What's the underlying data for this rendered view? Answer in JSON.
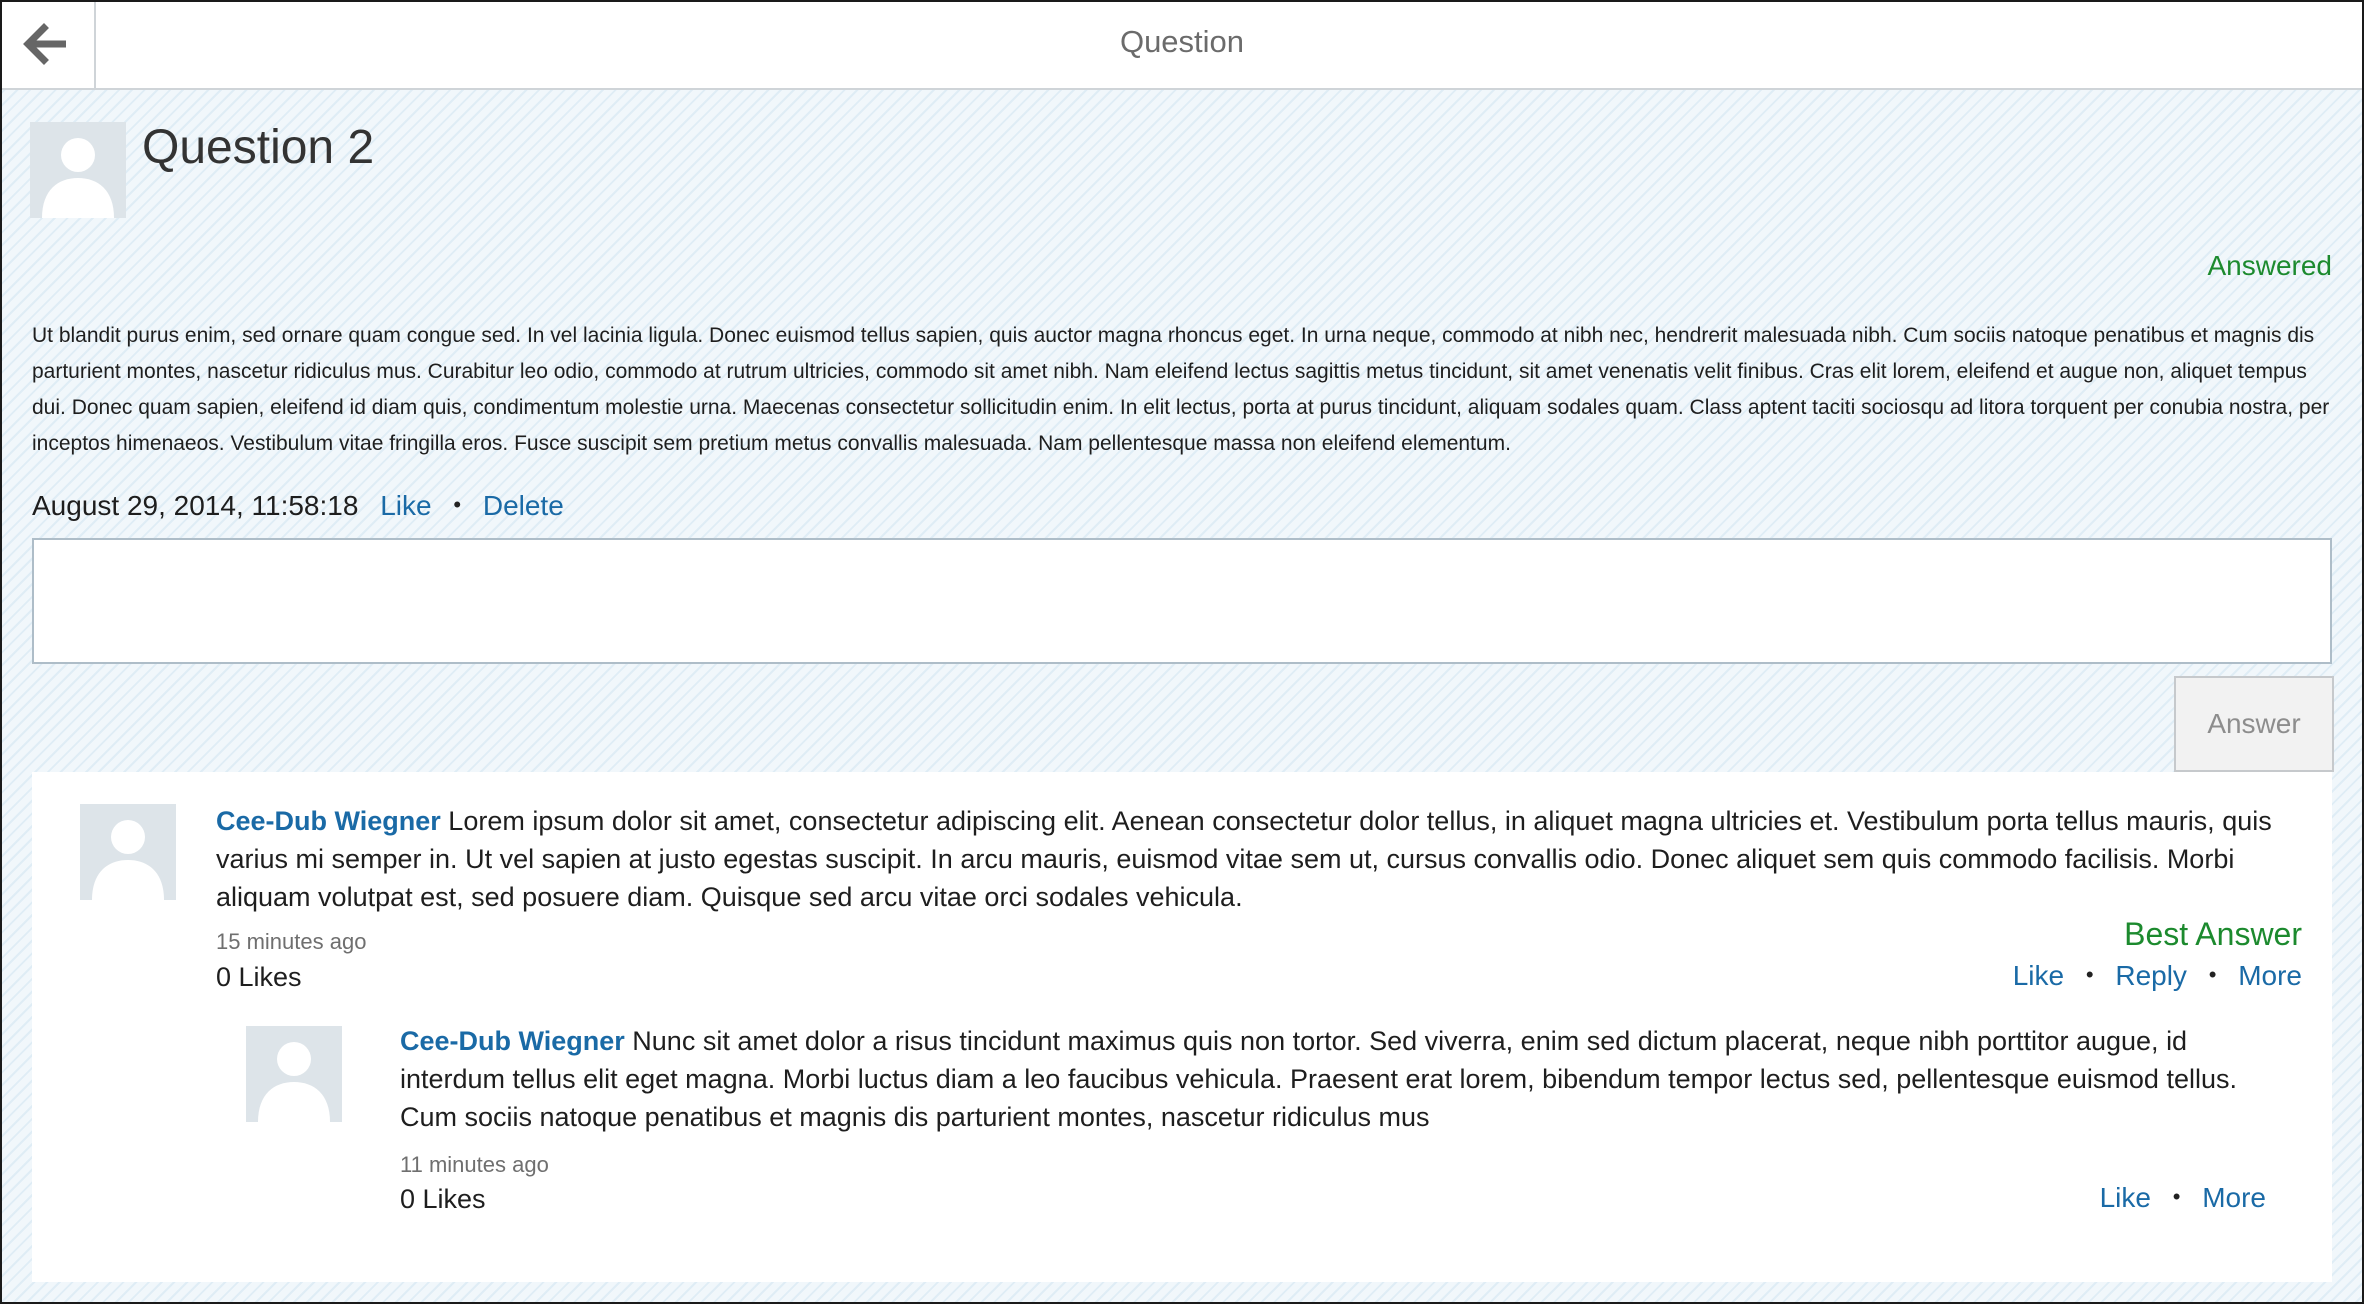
{
  "header": {
    "title": "Question",
    "back_icon": "arrow-left-icon"
  },
  "question": {
    "title": "Question 2",
    "status": "Answered",
    "body": "Ut blandit purus enim, sed ornare quam congue sed. In vel lacinia ligula. Donec euismod tellus sapien, quis auctor magna rhoncus eget. In urna neque, commodo at nibh nec, hendrerit malesuada nibh. Cum sociis natoque penatibus et magnis dis parturient montes, nascetur ridiculus mus. Curabitur leo odio, commodo at rutrum ultricies, commodo sit amet nibh. Nam eleifend lectus sagittis metus tincidunt, sit amet venenatis velit finibus. Cras elit lorem, eleifend et augue non, aliquet tempus dui. Donec quam sapien, eleifend id diam quis, condimentum molestie urna. Maecenas consectetur sollicitudin enim. In elit lectus, porta at purus tincidunt, aliquam sodales quam. Class aptent taciti sociosqu ad litora torquent per conubia nostra, per inceptos himenaeos. Vestibulum vitae fringilla eros. Fusce suscipit sem pretium metus convallis malesuada. Nam pellentesque massa non eleifend elementum.",
    "timestamp": "August 29, 2014, 11:58:18",
    "like_label": "Like",
    "delete_label": "Delete",
    "answer_placeholder": "",
    "answer_button_label": "Answer"
  },
  "answers": [
    {
      "author": "Cee-Dub Wiegner",
      "text": "Lorem ipsum dolor sit amet, consectetur adipiscing elit. Aenean consectetur dolor tellus, in aliquet magna ultricies et. Vestibulum porta tellus mauris, quis varius mi semper in. Ut vel sapien at justo egestas suscipit. In arcu mauris, euismod vitae sem ut, cursus convallis odio. Donec aliquet sem quis commodo facilisis. Morbi aliquam volutpat est, sed posuere diam. Quisque sed arcu vitae orci sodales vehicula.",
      "time": "15 minutes ago",
      "likes": "0 Likes",
      "badge": "Best Answer",
      "actions": {
        "like": "Like",
        "reply": "Reply",
        "more": "More"
      },
      "replies": [
        {
          "author": "Cee-Dub Wiegner",
          "text": "Nunc sit amet dolor a risus tincidunt maximus quis non tortor. Sed viverra, enim sed dictum placerat, neque nibh porttitor augue, id interdum tellus elit eget magna. Morbi luctus diam a leo faucibus vehicula. Praesent erat lorem, bibendum tempor lectus sed, pellentesque euismod tellus. Cum sociis natoque penatibus et magnis dis parturient montes, nascetur ridiculus mus",
          "time": "11 minutes ago",
          "likes": "0 Likes",
          "actions": {
            "like": "Like",
            "more": "More"
          }
        }
      ]
    }
  ],
  "colors": {
    "link": "#1a6aa6",
    "success": "#1c8a2e",
    "avatar_bg": "#dde4e9",
    "avatar_figure": "#ffffff"
  }
}
